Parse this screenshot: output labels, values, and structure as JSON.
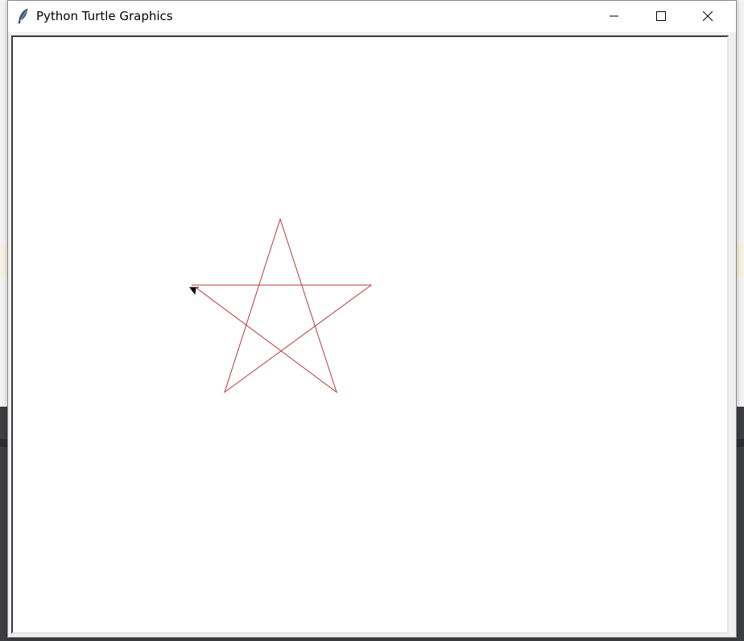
{
  "window": {
    "title": "Python Turtle Graphics",
    "app_icon": "feather-icon",
    "controls": [
      "minimize-icon",
      "maximize-icon",
      "close-icon"
    ]
  },
  "canvas": {
    "background": "#ffffff",
    "pen_color": "#b23a3a",
    "turtle_color": "#000000",
    "drawing": "five-pointed-star",
    "turtle_shape": "classic-arrow"
  }
}
